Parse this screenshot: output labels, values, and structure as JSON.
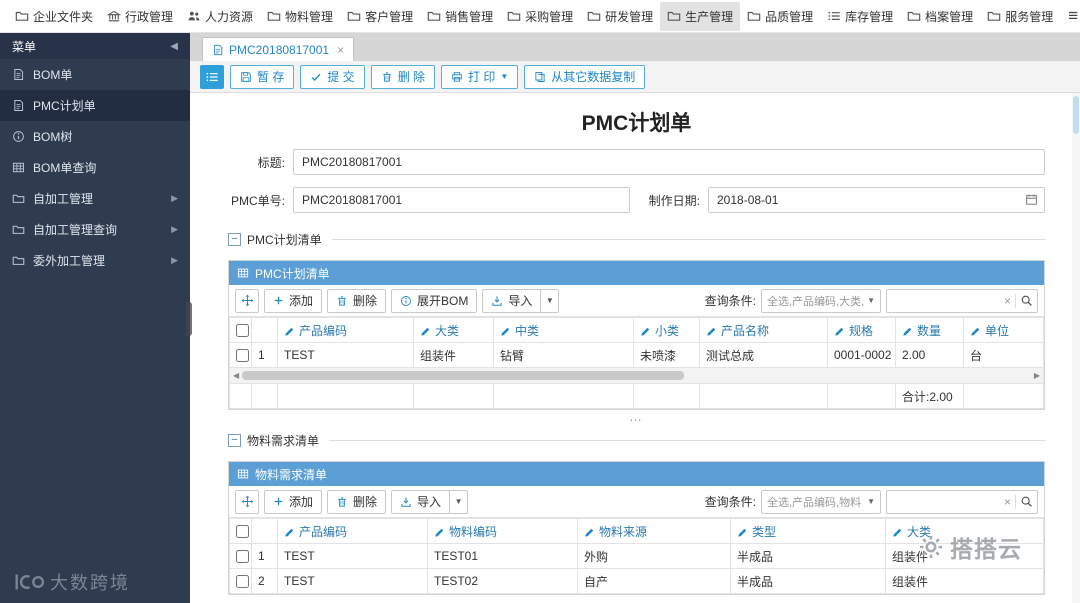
{
  "topnav": {
    "items": [
      {
        "label": "企业文件夹"
      },
      {
        "label": "行政管理"
      },
      {
        "label": "人力资源"
      },
      {
        "label": "物料管理"
      },
      {
        "label": "客户管理"
      },
      {
        "label": "销售管理"
      },
      {
        "label": "采购管理"
      },
      {
        "label": "研发管理"
      },
      {
        "label": "生产管理",
        "active": true
      },
      {
        "label": "品质管理"
      },
      {
        "label": "库存管理"
      },
      {
        "label": "档案管理"
      },
      {
        "label": "服务管理"
      }
    ]
  },
  "sidebar": {
    "title": "菜单",
    "items": [
      {
        "label": "BOM单"
      },
      {
        "label": "PMC计划单",
        "active": true
      },
      {
        "label": "BOM树"
      },
      {
        "label": "BOM单查询"
      },
      {
        "label": "自加工管理",
        "expandable": true
      },
      {
        "label": "自加工管理查询",
        "expandable": true
      },
      {
        "label": "委外加工管理",
        "expandable": true
      }
    ],
    "watermark": "大数跨境"
  },
  "tab": {
    "label": "PMC20180817001"
  },
  "toolbar": {
    "save": "暂 存",
    "submit": "提 交",
    "delete": "删 除",
    "print": "打 印",
    "copy_from": "从其它数据复制"
  },
  "page": {
    "title": "PMC计划单",
    "form": {
      "title_label": "标题:",
      "title_value": "PMC20180817001",
      "pmc_label": "PMC单号:",
      "pmc_value": "PMC20180817001",
      "date_label": "制作日期:",
      "date_value": "2018-08-01"
    }
  },
  "plan": {
    "legend": "PMC计划清单",
    "header": "PMC计划清单",
    "add": "添加",
    "delete": "删除",
    "expand_bom": "展开BOM",
    "import": "导入",
    "query_label": "查询条件:",
    "query_value": "全选,产品编码,大类,",
    "columns": [
      "产品编码",
      "大类",
      "中类",
      "小类",
      "产品名称",
      "规格",
      "数量",
      "单位"
    ],
    "rows": [
      {
        "no": "1",
        "cells": [
          "TEST",
          "组装件",
          "钻臂",
          "未喷漆",
          "测试总成",
          "0001-0002",
          "2.00",
          "台"
        ]
      }
    ],
    "total": "合计:2.00"
  },
  "material": {
    "legend": "物料需求清单",
    "header": "物料需求清单",
    "add": "添加",
    "delete": "删除",
    "import": "导入",
    "query_label": "查询条件:",
    "query_value": "全选,产品编码,物料",
    "columns": [
      "产品编码",
      "物料编码",
      "物料来源",
      "类型",
      "大类"
    ],
    "rows": [
      {
        "no": "1",
        "cells": [
          "TEST",
          "TEST01",
          "外购",
          "半成品",
          "组装件"
        ]
      },
      {
        "no": "2",
        "cells": [
          "TEST",
          "TEST02",
          "自产",
          "半成品",
          "组装件"
        ]
      }
    ]
  },
  "watermark_right": "搭搭云"
}
